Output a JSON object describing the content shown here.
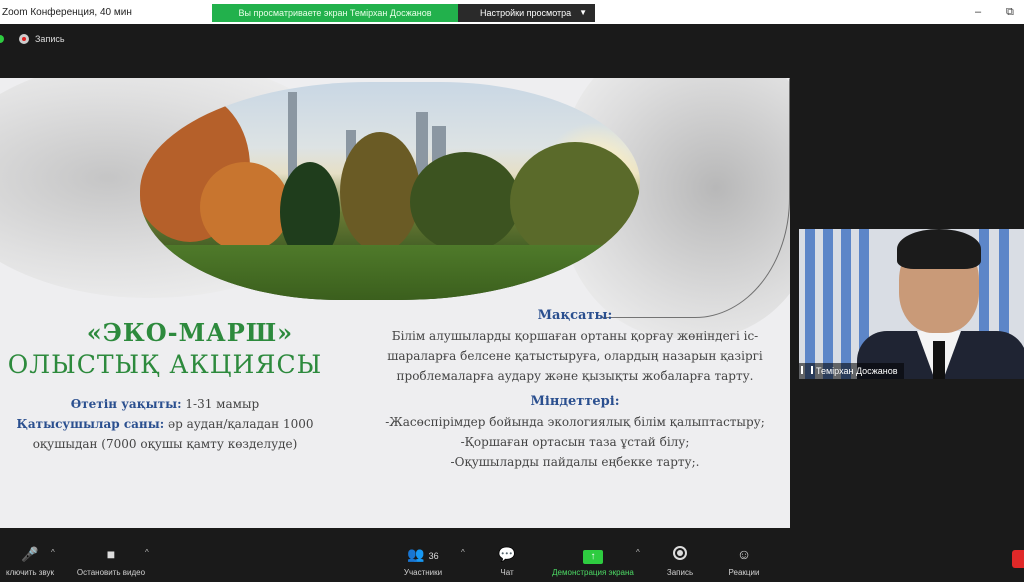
{
  "window": {
    "title": "Zoom Конференция, 40 мин",
    "minimize_glyph": "–",
    "restore_glyph": "⧉"
  },
  "share_banner": {
    "text": "Вы просматриваете экран Темірхан Досжанов",
    "view_settings_label": "Настройки просмотра",
    "color": "#22b14c"
  },
  "recording": {
    "label": "Запись"
  },
  "slide": {
    "title": "«ЭКО-МАРШ»",
    "subtitle": "ОЛЫСТЫҚ АКЦИЯСЫ",
    "left": {
      "time_label": "Өтетін уақыты:",
      "time_value": " 1-31 мамыр",
      "participants_label": "Қатысушылар саны:",
      "participants_value": " әр аудан/қаладан 1000",
      "participants_value_2": "оқушыдан (7000 оқушы қамту көзделуде)"
    },
    "right": {
      "goal_heading": "Мақсаты:",
      "goal_lines": [
        "Білім алушыларды қоршаған ортаны қорғау жөніндегі іс-",
        "шараларға белсене қатыстыруға, олардың назарын қазіргі",
        "проблемаларға аудару және қызықты жобаларға тарту."
      ],
      "tasks_heading": "Міндеттері:",
      "tasks_lines": [
        "-Жасөспірімдер бойында экологиялық білім қалыптастыру;",
        "-Қоршаған ортасын таза ұстай білу;",
        "-Оқушыларды пайдалы еңбекке тарту;."
      ]
    },
    "accent_green": "#2d8a3d",
    "accent_blue": "#2a4f8f"
  },
  "video_tile": {
    "participant_name": "Темірхан Досжанов"
  },
  "toolbar": {
    "mute_label": "ключить звук",
    "video_label": "Остановить видео",
    "participants_label": "Участники",
    "participants_count": "36",
    "chat_label": "Чат",
    "share_label": "Демонстрация экрана",
    "record_label": "Запись",
    "reactions_label": "Реакции",
    "caret_glyph": "^"
  },
  "icons": {
    "mic": "mic-muted-icon",
    "video": "video-camera-icon",
    "participants": "people-icon",
    "chat": "chat-bubble-icon",
    "share": "share-screen-icon",
    "record": "record-icon",
    "reactions": "emoji-icon"
  }
}
